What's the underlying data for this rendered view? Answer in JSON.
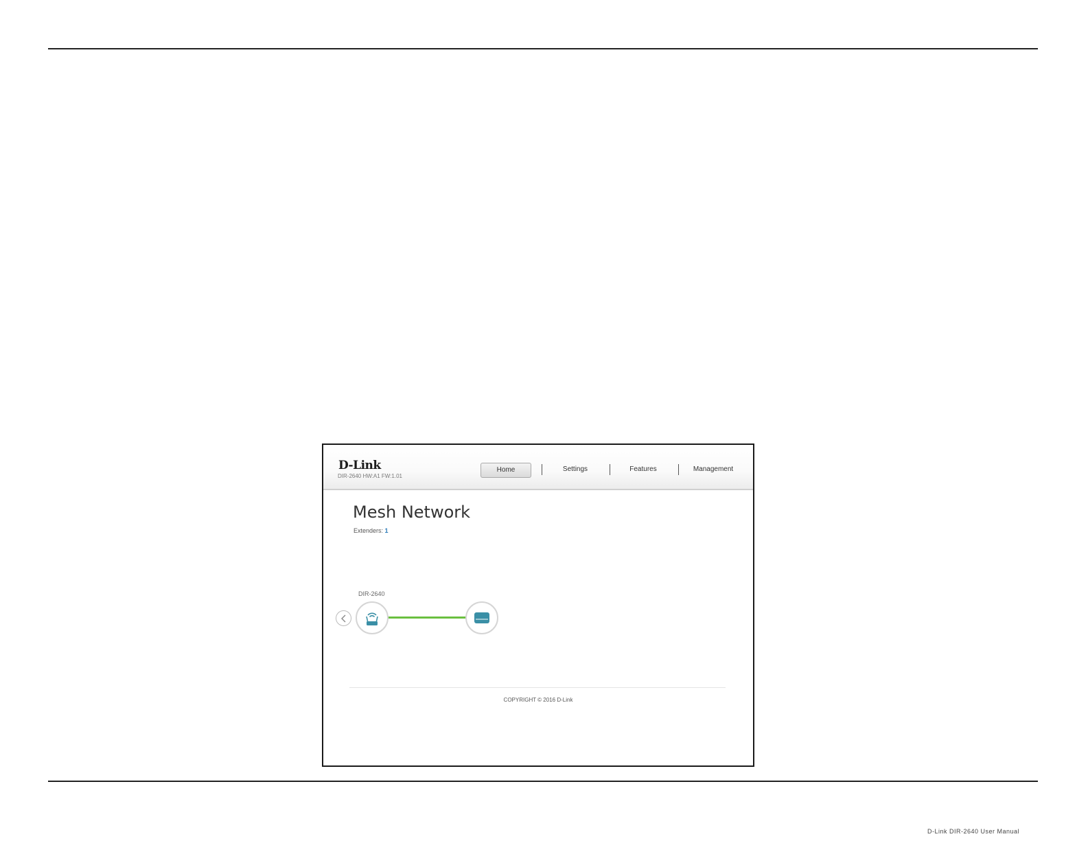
{
  "page": {
    "footer_note": "D-Link DIR-2640 User Manual"
  },
  "app": {
    "brand": "D-Link",
    "hw_info": "DIR-2640 HW:A1 FW:1.01"
  },
  "nav": {
    "items": [
      {
        "label": "Home",
        "active": true
      },
      {
        "label": "Settings",
        "active": false
      },
      {
        "label": "Features",
        "active": false
      },
      {
        "label": "Management",
        "active": false
      }
    ]
  },
  "main": {
    "title": "Mesh Network",
    "extenders_label": "Extenders:",
    "extenders_count": "1",
    "router_name": "DIR-2640"
  },
  "footer": {
    "copyright": "COPYRIGHT © 2016 D-Link"
  },
  "colors": {
    "accent": "#3a8fa6",
    "link_line": "#6abf3f",
    "extender_count": "#2a7ab8"
  },
  "icons": {
    "back": "chevron-left-icon",
    "router": "router-icon",
    "extender": "extender-icon"
  }
}
